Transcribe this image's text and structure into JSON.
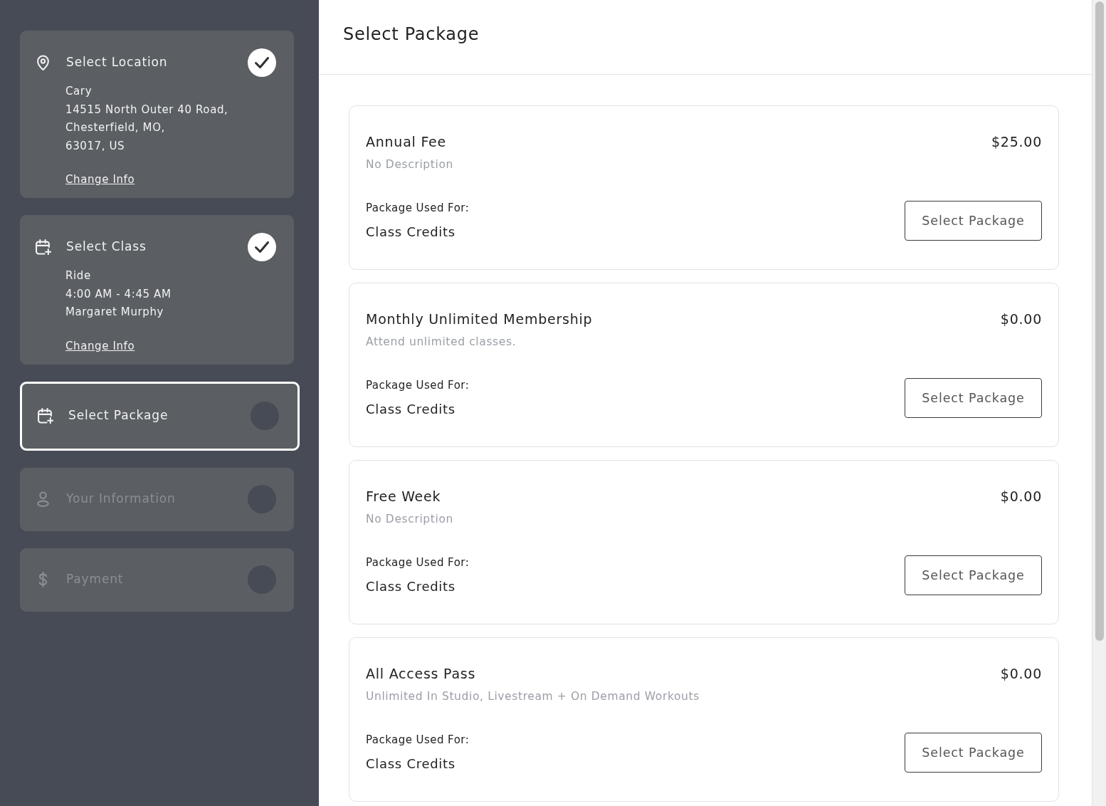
{
  "sidebar": {
    "steps": [
      {
        "kind": "location",
        "title": "Select Location",
        "details": [
          "Cary",
          "14515 North Outer 40 Road,",
          "Chesterfield, MO,",
          "63017, US"
        ],
        "link": "Change Info",
        "completed": true,
        "selected": false,
        "disabled": false
      },
      {
        "kind": "class",
        "title": "Select Class",
        "details": [
          "Ride",
          "4:00 AM - 4:45 AM",
          "Margaret Murphy"
        ],
        "link": "Change Info",
        "completed": true,
        "selected": false,
        "disabled": false
      },
      {
        "kind": "package",
        "title": "Select Package",
        "completed": false,
        "selected": true,
        "disabled": false
      },
      {
        "kind": "person",
        "title": "Your Information",
        "completed": false,
        "selected": false,
        "disabled": true
      },
      {
        "kind": "payment",
        "title": "Payment",
        "completed": false,
        "selected": false,
        "disabled": true
      }
    ]
  },
  "main": {
    "title": "Select Package",
    "packages": [
      {
        "name": "Annual Fee",
        "price": "$25.00",
        "description": "No Description",
        "used_for_label": "Package Used For:",
        "used_for": "Class Credits",
        "button": "Select Package"
      },
      {
        "name": "Monthly Unlimited Membership",
        "price": "$0.00",
        "description": "Attend unlimited classes.",
        "used_for_label": "Package Used For:",
        "used_for": "Class Credits",
        "button": "Select Package"
      },
      {
        "name": "Free Week",
        "price": "$0.00",
        "description": "No Description",
        "used_for_label": "Package Used For:",
        "used_for": "Class Credits",
        "button": "Select Package"
      },
      {
        "name": "All Access Pass",
        "price": "$0.00",
        "description": "Unlimited In Studio, Livestream + On Demand Workouts",
        "used_for_label": "Package Used For:",
        "used_for": "Class Credits",
        "button": "Select Package"
      }
    ]
  }
}
